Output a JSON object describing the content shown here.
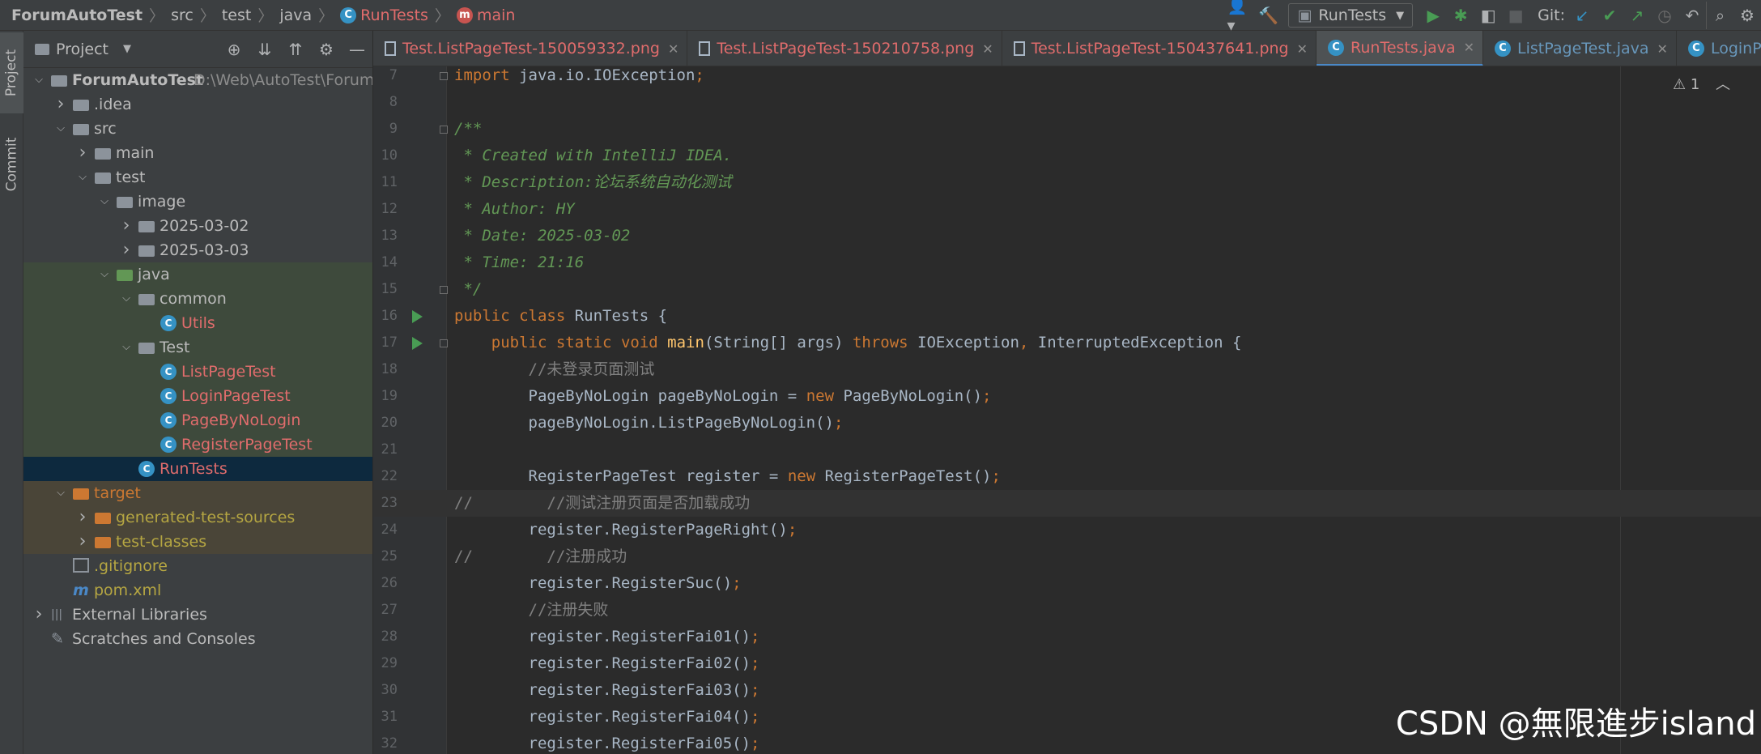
{
  "breadcrumb": [
    "ForumAutoTest",
    "src",
    "test",
    "java",
    "RunTests",
    "main"
  ],
  "toolbar": {
    "run_config": "RunTests",
    "git_label": "Git:",
    "icons": [
      "user-icon",
      "build-hammer-icon",
      "run-icon",
      "debug-icon",
      "coverage-icon",
      "stop-icon",
      "git-update-icon",
      "git-commit-icon",
      "git-push-icon",
      "history-icon",
      "rollback-icon",
      "search-icon"
    ]
  },
  "side_tabs": {
    "project": "Project",
    "commit": "Commit"
  },
  "project_panel": {
    "title": "Project",
    "tree": [
      {
        "label": "ForumAutoTest",
        "path": "D:\\Web\\AutoTest\\Forum",
        "type": "module",
        "depth": 0,
        "open": true
      },
      {
        "label": ".idea",
        "type": "folder",
        "depth": 1,
        "open": false
      },
      {
        "label": "src",
        "type": "folder",
        "depth": 1,
        "open": true
      },
      {
        "label": "main",
        "type": "folder",
        "depth": 2,
        "open": false
      },
      {
        "label": "test",
        "type": "folder",
        "depth": 2,
        "open": true
      },
      {
        "label": "image",
        "type": "folder",
        "depth": 3,
        "open": true
      },
      {
        "label": "2025-03-02",
        "type": "folder",
        "depth": 4,
        "open": false
      },
      {
        "label": "2025-03-03",
        "type": "folder",
        "depth": 4,
        "open": false
      },
      {
        "label": "java",
        "type": "src-folder",
        "depth": 3,
        "open": true,
        "hl": "green"
      },
      {
        "label": "common",
        "type": "package",
        "depth": 4,
        "open": true,
        "hl": "green"
      },
      {
        "label": "Utils",
        "type": "class",
        "depth": 5,
        "hl": "green",
        "color": "red"
      },
      {
        "label": "Test",
        "type": "package",
        "depth": 4,
        "open": true,
        "hl": "green"
      },
      {
        "label": "ListPageTest",
        "type": "class",
        "depth": 5,
        "hl": "green",
        "color": "red"
      },
      {
        "label": "LoginPageTest",
        "type": "class",
        "depth": 5,
        "hl": "green",
        "color": "red"
      },
      {
        "label": "PageByNoLogin",
        "type": "class",
        "depth": 5,
        "hl": "green",
        "color": "red"
      },
      {
        "label": "RegisterPageTest",
        "type": "class",
        "depth": 5,
        "hl": "green",
        "color": "red"
      },
      {
        "label": "RunTests",
        "type": "class",
        "depth": 4,
        "hl": "sel",
        "color": "red"
      },
      {
        "label": "target",
        "type": "target-folder",
        "depth": 1,
        "open": true,
        "hl": "target",
        "color": "orange"
      },
      {
        "label": "generated-test-sources",
        "type": "target-folder",
        "depth": 2,
        "open": false,
        "hl": "target",
        "color": "olive"
      },
      {
        "label": "test-classes",
        "type": "target-folder",
        "depth": 2,
        "open": false,
        "hl": "target",
        "color": "olive"
      },
      {
        "label": ".gitignore",
        "type": "file",
        "depth": 1,
        "color": "olive"
      },
      {
        "label": "pom.xml",
        "type": "maven",
        "depth": 1,
        "color": "olive"
      },
      {
        "label": "External Libraries",
        "type": "libs",
        "depth": 0,
        "open": false
      },
      {
        "label": "Scratches and Consoles",
        "type": "scratch",
        "depth": 0
      }
    ]
  },
  "tabs": [
    {
      "label": "Test.ListPageTest-150059332.png",
      "kind": "image",
      "active": false
    },
    {
      "label": "Test.ListPageTest-150210758.png",
      "kind": "image",
      "active": false
    },
    {
      "label": "Test.ListPageTest-150437641.png",
      "kind": "image",
      "active": false
    },
    {
      "label": "RunTests.java",
      "kind": "class",
      "active": true
    },
    {
      "label": "ListPageTest.java",
      "kind": "class",
      "active": false
    },
    {
      "label": "LoginPageT",
      "kind": "class",
      "active": false
    }
  ],
  "editor": {
    "warning": "1",
    "current_line": 23,
    "lines": [
      {
        "n": 7,
        "code": "import java.io.IOException;"
      },
      {
        "n": 8,
        "code": ""
      },
      {
        "n": 9,
        "code": "/**"
      },
      {
        "n": 10,
        "code": " * Created with IntelliJ IDEA."
      },
      {
        "n": 11,
        "code": " * Description:论坛系统自动化测试"
      },
      {
        "n": 12,
        "code": " * Author: HY"
      },
      {
        "n": 13,
        "code": " * Date: 2025-03-02"
      },
      {
        "n": 14,
        "code": " * Time: 21:16"
      },
      {
        "n": 15,
        "code": " */"
      },
      {
        "n": 16,
        "code": "public class RunTests {"
      },
      {
        "n": 17,
        "code": "    public static void main(String[] args) throws IOException, InterruptedException {"
      },
      {
        "n": 18,
        "code": "        //未登录页面测试"
      },
      {
        "n": 19,
        "code": "        PageByNoLogin pageByNoLogin = new PageByNoLogin();"
      },
      {
        "n": 20,
        "code": "        pageByNoLogin.ListPageByNoLogin();"
      },
      {
        "n": 21,
        "code": ""
      },
      {
        "n": 22,
        "code": "        RegisterPageTest register = new RegisterPageTest();"
      },
      {
        "n": 23,
        "code": "//        //测试注册页面是否加载成功"
      },
      {
        "n": 24,
        "code": "        register.RegisterPageRight();"
      },
      {
        "n": 25,
        "code": "//        //注册成功"
      },
      {
        "n": 26,
        "code": "        register.RegisterSuc();"
      },
      {
        "n": 27,
        "code": "        //注册失败"
      },
      {
        "n": 28,
        "code": "        register.RegisterFai01();"
      },
      {
        "n": 29,
        "code": "        register.RegisterFai02();"
      },
      {
        "n": 30,
        "code": "        register.RegisterFai03();"
      },
      {
        "n": 31,
        "code": "        register.RegisterFai04();"
      },
      {
        "n": 32,
        "code": "        register.RegisterFai05();"
      }
    ]
  },
  "watermark": "CSDN @無限進步island",
  "colors": {
    "keyword": "#cc7832",
    "comment": "#808080",
    "doc": "#629755",
    "method": "#ffc66d",
    "text": "#a9b7c6",
    "error_file": "#e06c6c",
    "accent": "#4a88c7"
  }
}
